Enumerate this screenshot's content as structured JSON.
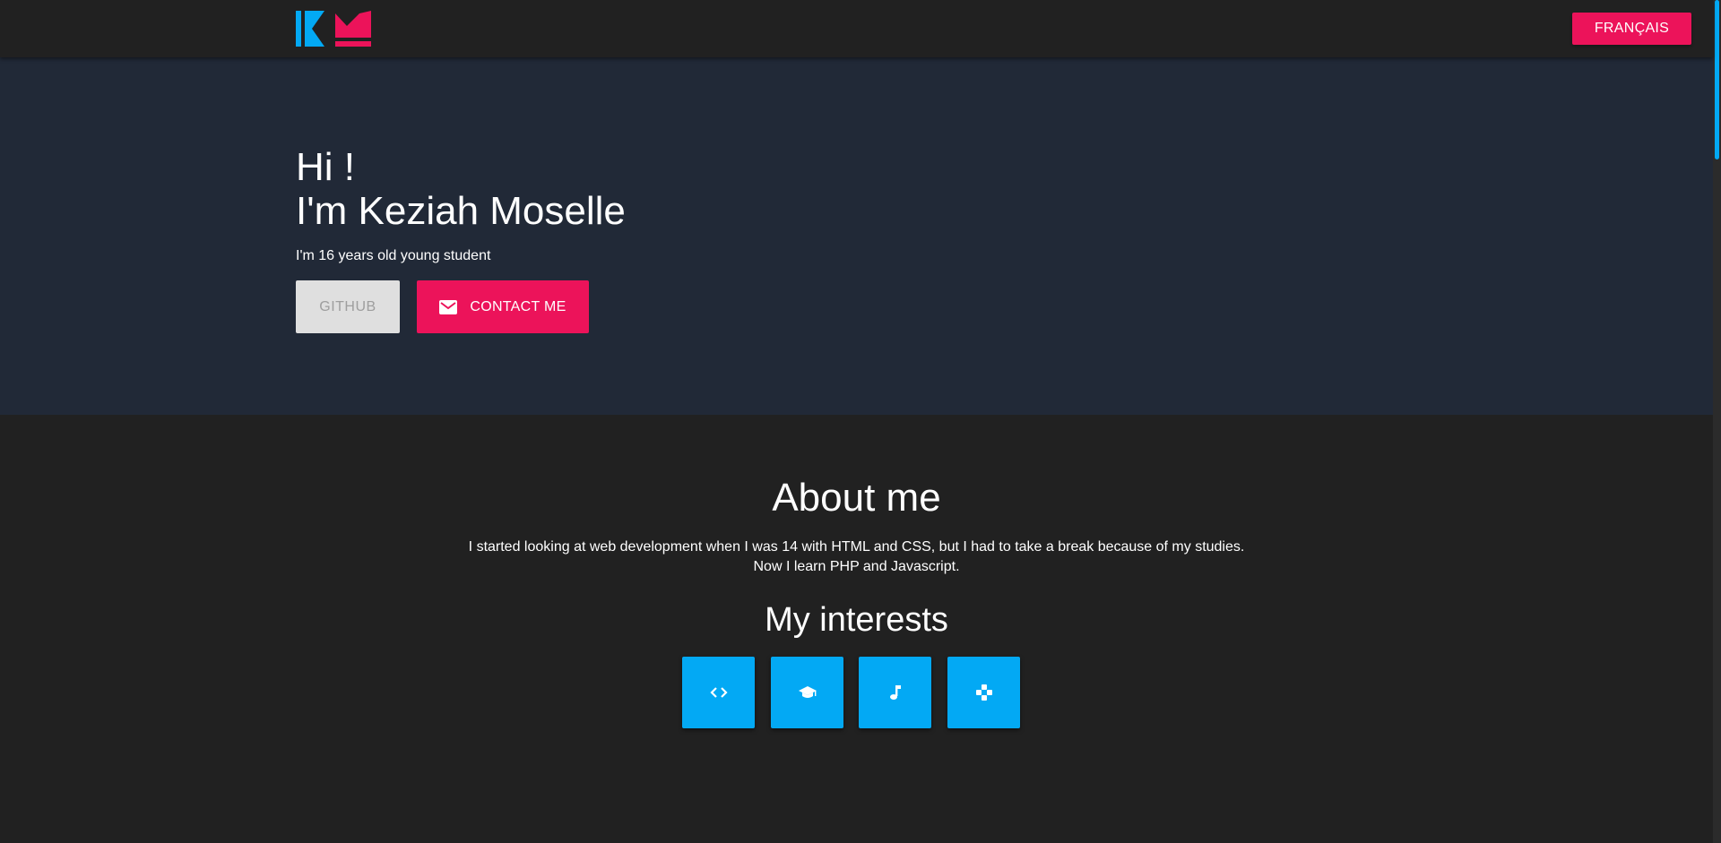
{
  "header": {
    "logo_icon": "km-monogram-logo",
    "language_button": "FRANÇAIS"
  },
  "hero": {
    "greeting": "Hi !",
    "name": "I'm Keziah Moselle",
    "subtitle": "I'm 16 years old young student",
    "github_button": "GITHUB",
    "contact_button": "CONTACT ME",
    "contact_icon": "mail-icon"
  },
  "about": {
    "title": "About me",
    "text_line1": "I started looking at web development when I was 14 with HTML and CSS, but I had to take a break because of my studies.",
    "text_line2": "Now I learn PHP and Javascript.",
    "interests_title": "My interests",
    "interests": [
      {
        "icon": "code-icon"
      },
      {
        "icon": "graduation-cap-icon"
      },
      {
        "icon": "music-note-icon"
      },
      {
        "icon": "gamepad-icon"
      }
    ]
  },
  "colors": {
    "accent_pink": "#ec135a",
    "accent_blue": "#03a9f4",
    "hero_bg": "#212937",
    "page_bg": "#212121"
  }
}
